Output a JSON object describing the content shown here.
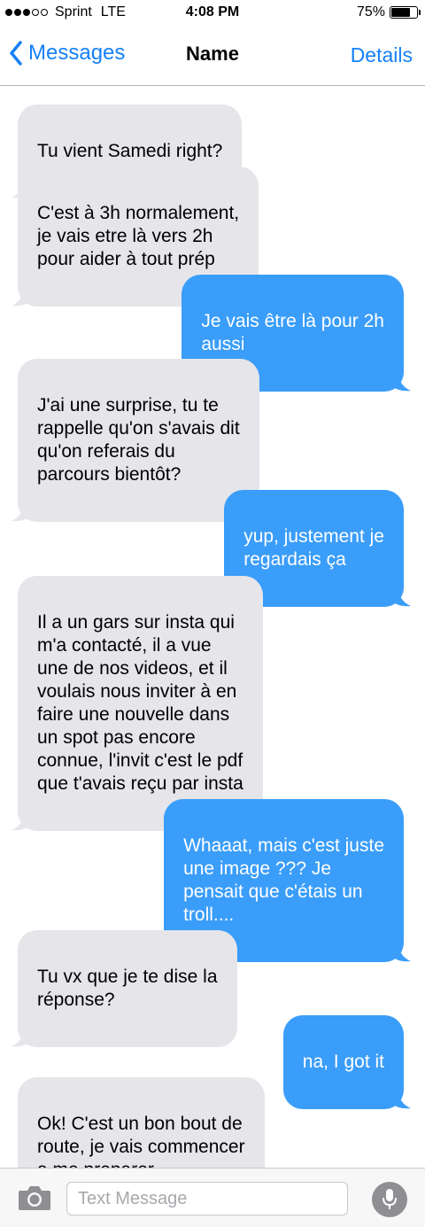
{
  "status_bar": {
    "carrier": "Sprint",
    "network": "LTE",
    "time": "4:08 PM",
    "battery_text": "75%",
    "battery_level": 0.75,
    "signal_bars_filled": 3,
    "signal_bars_total": 5
  },
  "nav": {
    "back_label": "Messages",
    "title": "Name",
    "details_label": "Details"
  },
  "messages": [
    {
      "direction": "received",
      "text": "Tu vient Samedi right?"
    },
    {
      "direction": "received",
      "text": "C'est à 3h normalement,\nje vais etre là vers 2h\npour aider à tout prép"
    },
    {
      "direction": "sent",
      "text": "Je vais être là pour 2h\naussi"
    },
    {
      "direction": "received",
      "text": "J'ai une surprise, tu te\nrappelle qu'on s'avais dit\nqu'on referais du\nparcours bientôt?"
    },
    {
      "direction": "sent",
      "text": "yup, justement je\nregardais ça"
    },
    {
      "direction": "received",
      "text": "Il a un gars sur insta qui\nm'a contacté, il a vue\nune de nos videos, et il\nvoulais nous inviter à en\nfaire une nouvelle dans\nun spot pas encore\nconnue, l'invit c'est le pdf\nque t'avais reçu par insta"
    },
    {
      "direction": "sent",
      "text": "Whaaat, mais c'est juste\nune image ??? Je\npensait que c'étais un\ntroll...."
    },
    {
      "direction": "received",
      "text": "Tu vx que je te dise la\nréponse?"
    },
    {
      "direction": "sent",
      "text": "na, I got it"
    },
    {
      "direction": "received",
      "text": "Ok! C'est un bon bout de\nroute, je vais commencer\na me preparer"
    }
  ],
  "input_bar": {
    "placeholder": "Text Message",
    "camera_icon": "camera-icon",
    "mic_icon": "microphone-icon"
  },
  "colors": {
    "accent": "#1581f7",
    "sent_bubble": "#3a9df9",
    "received_bubble": "#e5e5ea"
  }
}
